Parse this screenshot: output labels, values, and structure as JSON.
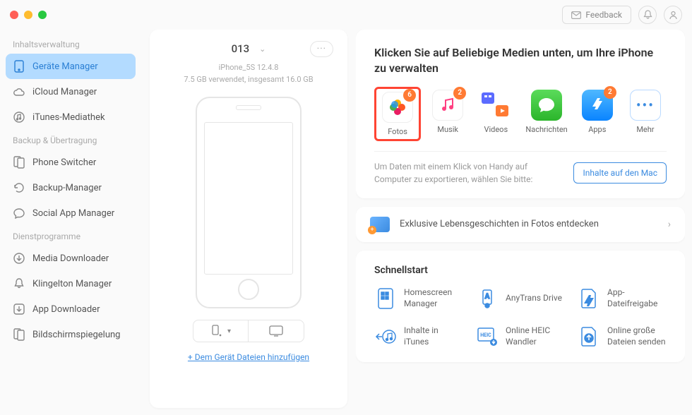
{
  "topbar": {
    "feedback": "Feedback"
  },
  "sidebar": {
    "groups": [
      {
        "title": "Inhaltsverwaltung",
        "items": [
          {
            "label": "Geräte Manager",
            "active": true
          },
          {
            "label": "iCloud Manager"
          },
          {
            "label": "iTunes-Mediathek"
          }
        ]
      },
      {
        "title": "Backup & Übertragung",
        "items": [
          {
            "label": "Phone Switcher"
          },
          {
            "label": "Backup-Manager"
          },
          {
            "label": "Social App Manager"
          }
        ]
      },
      {
        "title": "Dienstprogramme",
        "items": [
          {
            "label": "Media Downloader"
          },
          {
            "label": "Klingelton Manager"
          },
          {
            "label": "App Downloader"
          },
          {
            "label": "Bildschirmspiegelung"
          }
        ]
      }
    ]
  },
  "device": {
    "name": "013",
    "model": "iPhone_5S 12.4.8",
    "storage": "7.5 GB verwendet, insgesamt  16.0 GB",
    "add_files": "+ Dem Gerät Dateien hinzufügen"
  },
  "media": {
    "title": "Klicken Sie auf Beliebige Medien unten, um Ihre iPhone zu verwalten",
    "items": [
      {
        "label": "Fotos",
        "badge": "6",
        "highlight": true
      },
      {
        "label": "Musik",
        "badge": "2"
      },
      {
        "label": "Videos"
      },
      {
        "label": "Nachrichten"
      },
      {
        "label": "Apps",
        "badge": "2"
      },
      {
        "label": "Mehr"
      }
    ],
    "export_text": "Um Daten mit einem Klick von Handy auf Computer zu exportieren, wählen Sie bitte:",
    "export_btn": "Inhalte auf den Mac"
  },
  "promo": {
    "text": "Exklusive Lebensgeschichten in Fotos entdecken"
  },
  "quick": {
    "title": "Schnellstart",
    "items": [
      {
        "label": "Homescreen Manager"
      },
      {
        "label": "AnyTrans Drive"
      },
      {
        "label": "App-Dateifreigabe"
      },
      {
        "label": "Inhalte in iTunes"
      },
      {
        "label": "Online HEIC Wandler"
      },
      {
        "label": "Online große Dateien senden"
      }
    ]
  }
}
